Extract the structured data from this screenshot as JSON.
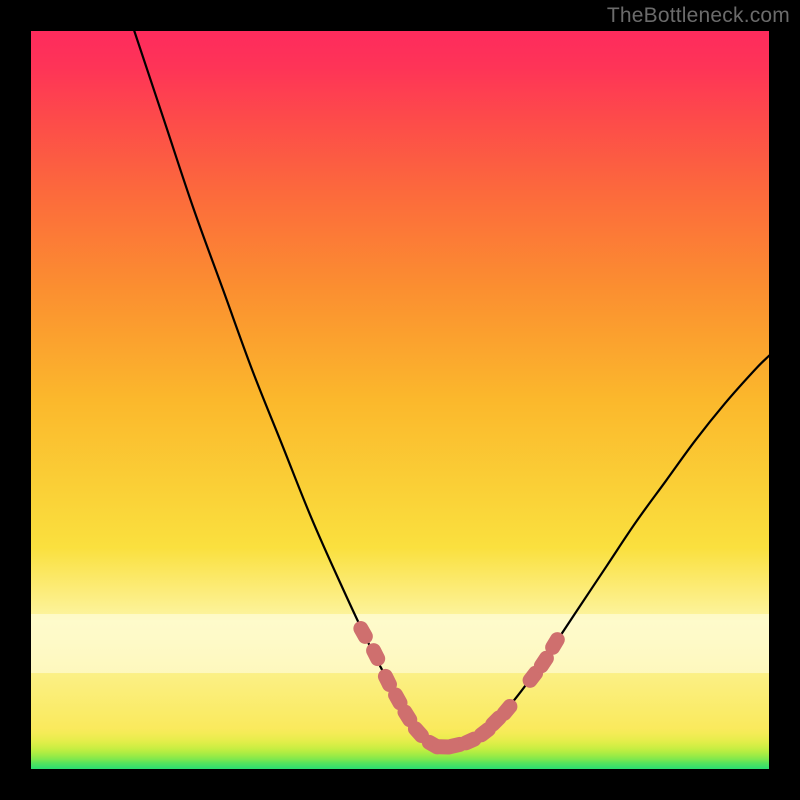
{
  "watermark": "TheBottleneck.com",
  "chart_data": {
    "type": "line",
    "title": "",
    "xlabel": "",
    "ylabel": "",
    "xlim": [
      0,
      100
    ],
    "ylim": [
      0,
      100
    ],
    "series": [
      {
        "name": "left-curve",
        "x": [
          14.0,
          18.0,
          22.0,
          26.0,
          30.0,
          34.0,
          38.0,
          42.0,
          46.0,
          50.0,
          52.0,
          54.0,
          56.0
        ],
        "y": [
          100.0,
          88.0,
          76.0,
          65.0,
          54.0,
          44.0,
          34.0,
          25.0,
          16.5,
          9.0,
          6.0,
          4.0,
          3.0
        ]
      },
      {
        "name": "right-curve",
        "x": [
          56.0,
          58.0,
          60.0,
          63.0,
          66.0,
          70.0,
          74.0,
          78.0,
          82.0,
          86.0,
          90.0,
          94.0,
          98.0,
          100.0
        ],
        "y": [
          3.0,
          3.2,
          4.0,
          6.5,
          10.0,
          15.5,
          21.5,
          27.5,
          33.5,
          39.0,
          44.5,
          49.5,
          54.0,
          56.0
        ]
      }
    ],
    "markers": {
      "name": "bead-markers",
      "color": "#cf6f6e",
      "points": [
        {
          "x": 45.0,
          "y": 18.5
        },
        {
          "x": 46.7,
          "y": 15.5
        },
        {
          "x": 48.3,
          "y": 12.0
        },
        {
          "x": 49.7,
          "y": 9.5
        },
        {
          "x": 51.0,
          "y": 7.2
        },
        {
          "x": 52.5,
          "y": 5.0
        },
        {
          "x": 54.5,
          "y": 3.3
        },
        {
          "x": 56.0,
          "y": 3.0
        },
        {
          "x": 57.5,
          "y": 3.2
        },
        {
          "x": 59.5,
          "y": 3.8
        },
        {
          "x": 61.5,
          "y": 5.0
        },
        {
          "x": 63.0,
          "y": 6.5
        },
        {
          "x": 64.5,
          "y": 8.0
        },
        {
          "x": 68.0,
          "y": 12.5
        },
        {
          "x": 69.5,
          "y": 14.5
        },
        {
          "x": 71.0,
          "y": 17.0
        }
      ]
    },
    "gradient_bands": [
      {
        "color": "#29df72",
        "y": 0.0
      },
      {
        "color": "#5be55a",
        "y": 0.9
      },
      {
        "color": "#7de84f",
        "y": 1.3
      },
      {
        "color": "#9aeb46",
        "y": 1.8
      },
      {
        "color": "#b3ed42",
        "y": 2.3
      },
      {
        "color": "#c8ee43",
        "y": 2.8
      },
      {
        "color": "#daee47",
        "y": 3.4
      },
      {
        "color": "#e8ed4d",
        "y": 4.0
      },
      {
        "color": "#f3ec55",
        "y": 4.7
      },
      {
        "color": "#faea5d",
        "y": 5.5
      },
      {
        "color": "#fcf39b",
        "y": 17.0
      },
      {
        "color": "#fdf5a4",
        "y": 20.0
      },
      {
        "color": "#fae03e",
        "y": 30.0
      },
      {
        "color": "#fbb82c",
        "y": 50.0
      },
      {
        "color": "#fb8f30",
        "y": 65.0
      },
      {
        "color": "#fc6a3c",
        "y": 78.0
      },
      {
        "color": "#fd4b4a",
        "y": 88.0
      },
      {
        "color": "#fe3457",
        "y": 95.0
      },
      {
        "color": "#fe2b5d",
        "y": 100.0
      }
    ]
  }
}
